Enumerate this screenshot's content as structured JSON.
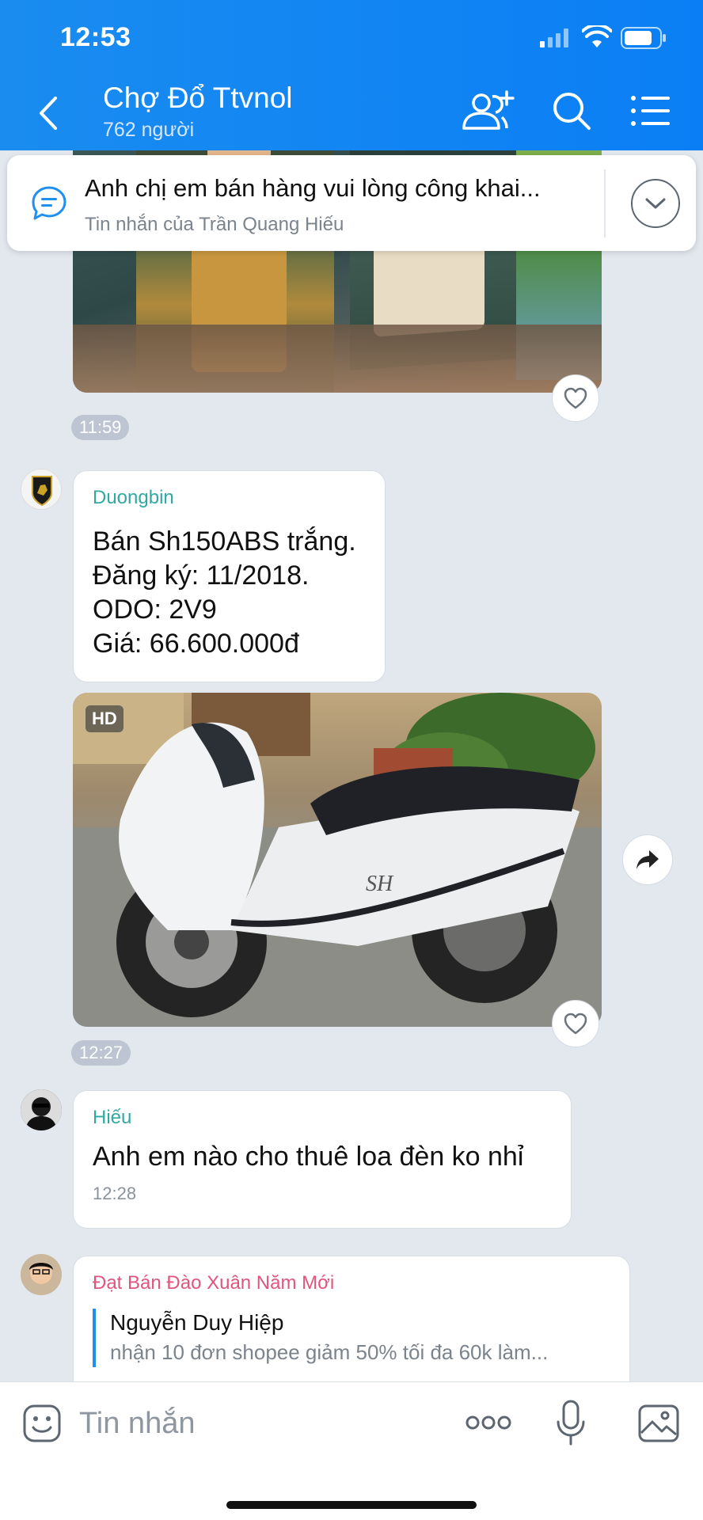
{
  "status_bar": {
    "time": "12:53"
  },
  "header": {
    "title": "Chợ Đổ Ttvnol",
    "member_count": "762 người"
  },
  "pinned": {
    "text": "Anh chị em bán hàng vui lòng công khai...",
    "sub": "Tin nhắn của Trần Quang Hiếu"
  },
  "messages": {
    "photo1_time": "11:59",
    "duongbin": {
      "sender": "Duongbin",
      "lines": [
        "Bán Sh150ABS trắng.",
        "Đăng ký: 11/2018.",
        "ODO: 2V9",
        "Giá: 66.600.000đ"
      ],
      "photo_badge": "HD",
      "photo_time": "12:27"
    },
    "hieu": {
      "sender": "Hiếu",
      "text": "Anh em nào cho thuê loa đèn ko nhỉ",
      "time": "12:28"
    },
    "dat": {
      "sender": "Đạt Bán Đào Xuân Năm Mới",
      "quote_name": "Nguyễn Duy Hiệp",
      "quote_text": "nhận 10 đơn shopee giảm 50% tối đa 60k làm..."
    }
  },
  "input": {
    "placeholder": "Tin nhắn"
  },
  "colors": {
    "header_blue": "#0a7ff5",
    "chat_bg": "#e3e8ef",
    "sender_teal": "#2fa9a2",
    "sender_pink": "#e0557d"
  }
}
